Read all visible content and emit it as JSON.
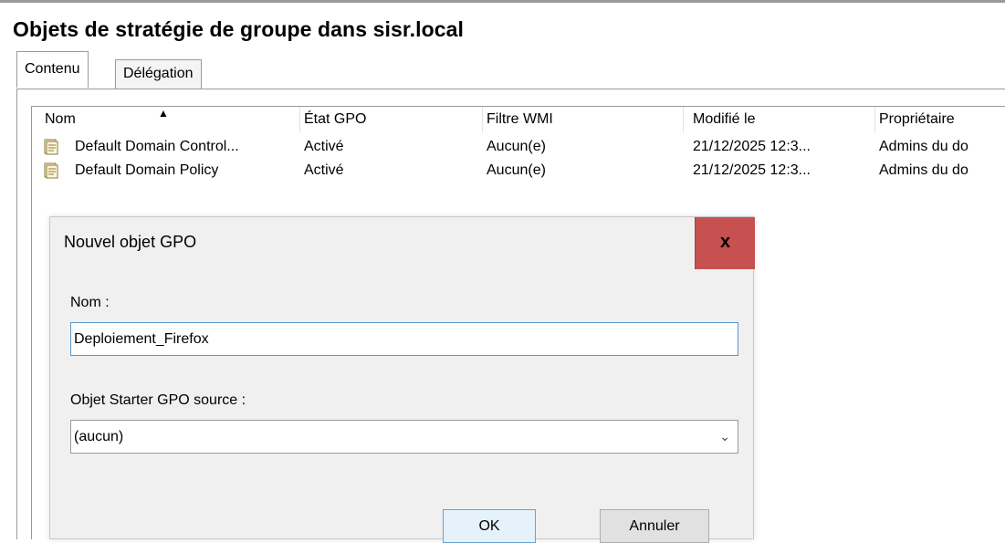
{
  "page": {
    "title": "Objets de stratégie de groupe dans sisr.local"
  },
  "tabs": [
    {
      "label": "Contenu",
      "active": true
    },
    {
      "label": "Délégation",
      "active": false
    }
  ],
  "list": {
    "columns": [
      "Nom",
      "État GPO",
      "Filtre WMI",
      "Modifié le",
      "Propriétaire"
    ],
    "sort_indicator": "▲",
    "rows": [
      {
        "icon": "gpo-document-icon",
        "name": "Default Domain Control...",
        "state": "Activé",
        "wmi": "Aucun(e)",
        "modified": "21/12/2025 12:3...",
        "owner": "Admins du do"
      },
      {
        "icon": "gpo-document-icon",
        "name": "Default Domain Policy",
        "state": "Activé",
        "wmi": "Aucun(e)",
        "modified": "21/12/2025 12:3...",
        "owner": "Admins du do"
      }
    ]
  },
  "dialog": {
    "title": "Nouvel objet GPO",
    "close_glyph": "x",
    "close_color": "#c75050",
    "name_label": "Nom :",
    "name_value": "Deploiement_Firefox",
    "starter_label": "Objet Starter GPO source :",
    "starter_value": "(aucun)",
    "starter_chevron": "⌄",
    "ok_label": "OK",
    "cancel_label": "Annuler"
  }
}
